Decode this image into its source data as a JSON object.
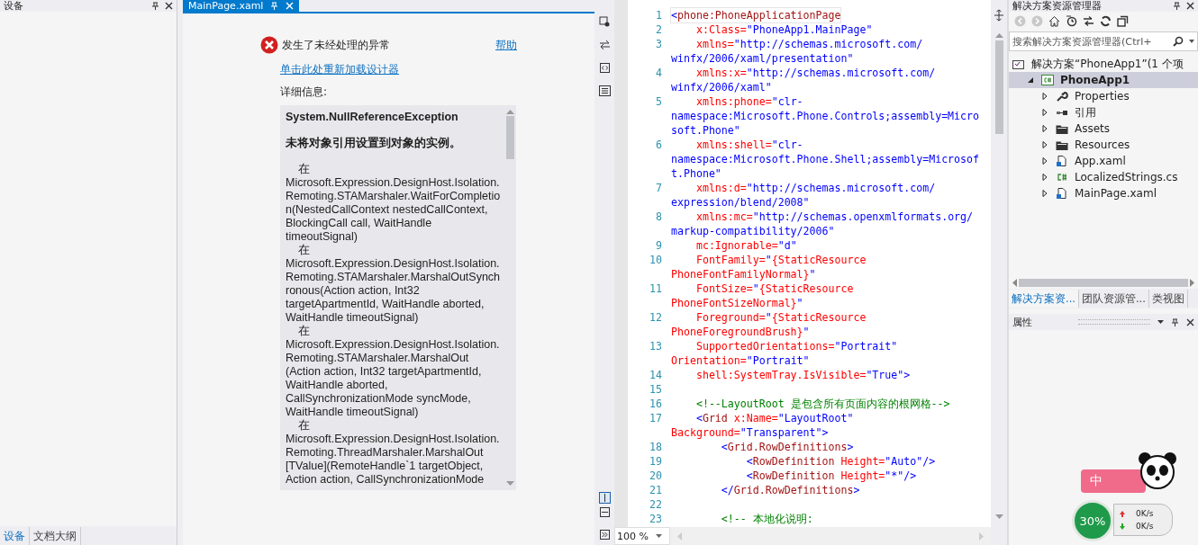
{
  "left_pane": {
    "title": "设备",
    "tabs": [
      {
        "label": "设备",
        "selected": true
      },
      {
        "label": "文档大纲",
        "selected": false
      }
    ]
  },
  "document_tab": {
    "title": "MainPage.xaml",
    "selected": true
  },
  "designer": {
    "error_title": "发生了未经处理的异常",
    "help_link": "帮助",
    "reload_link": "单击此处重新加载设计器",
    "details_label": "详细信息:",
    "exception": "System.NullReferenceException",
    "message": "未将对象引用设置到对象的实例。",
    "stack": [
      {
        "prefix": "在",
        "frame": "Microsoft.Expression.DesignHost.Isolation.Remoting.STAMarshaler.WaitForCompletion(NestedCallContext nestedCallContext, BlockingCall call, WaitHandle timeoutSignal)"
      },
      {
        "prefix": "在",
        "frame": "Microsoft.Expression.DesignHost.Isolation.Remoting.STAMarshaler.MarshalOutSynchronous(Action action, Int32 targetApartmentId, WaitHandle aborted, WaitHandle timeoutSignal)"
      },
      {
        "prefix": "在",
        "frame": "Microsoft.Expression.DesignHost.Isolation.Remoting.STAMarshaler.MarshalOut (Action action, Int32 targetApartmentId, WaitHandle aborted, CallSynchronizationMode syncMode, WaitHandle timeoutSignal)"
      },
      {
        "prefix": "在",
        "frame": "Microsoft.Expression.DesignHost.Isolation.Remoting.ThreadMarshaler.MarshalOut [TValue](RemoteHandle`1 targetObject, Action action, CallSynchronizationMode"
      }
    ]
  },
  "editor": {
    "zoom": "100 %",
    "lines": [
      {
        "number": "1",
        "rows": [
          {
            "segments": [
              {
                "kind": "punct",
                "text": "<"
              },
              {
                "kind": "element",
                "text": "phone:PhoneApplicationPage"
              }
            ]
          }
        ]
      },
      {
        "number": "2",
        "rows": [
          {
            "segments": [
              {
                "kind": "attribute",
                "text": "    x:Class="
              },
              {
                "kind": "value",
                "text": "\"PhoneApp1.MainPage\""
              }
            ]
          }
        ]
      },
      {
        "number": "3",
        "rows": [
          {
            "segments": [
              {
                "kind": "attribute",
                "text": "    xmlns="
              },
              {
                "kind": "value",
                "text": "\"http://schemas.microsoft.com/"
              }
            ]
          },
          {
            "segments": [
              {
                "kind": "value",
                "text": "winfx/2006/xaml/presentation\""
              }
            ]
          }
        ]
      },
      {
        "number": "4",
        "rows": [
          {
            "segments": [
              {
                "kind": "attribute",
                "text": "    xmlns:x="
              },
              {
                "kind": "value",
                "text": "\"http://schemas.microsoft.com/"
              }
            ]
          },
          {
            "segments": [
              {
                "kind": "value",
                "text": "winfx/2006/xaml\""
              }
            ]
          }
        ]
      },
      {
        "number": "5",
        "rows": [
          {
            "segments": [
              {
                "kind": "attribute",
                "text": "    xmlns:phone="
              },
              {
                "kind": "value",
                "text": "\"clr-"
              }
            ]
          },
          {
            "segments": [
              {
                "kind": "value",
                "text": "namespace:Microsoft.Phone.Controls;assembly=Micro"
              }
            ]
          },
          {
            "segments": [
              {
                "kind": "value",
                "text": "soft.Phone\""
              }
            ]
          }
        ]
      },
      {
        "number": "6",
        "rows": [
          {
            "segments": [
              {
                "kind": "attribute",
                "text": "    xmlns:shell="
              },
              {
                "kind": "value",
                "text": "\"clr-"
              }
            ]
          },
          {
            "segments": [
              {
                "kind": "value",
                "text": "namespace:Microsoft.Phone.Shell;assembly=Microsof"
              }
            ]
          },
          {
            "segments": [
              {
                "kind": "value",
                "text": "t.Phone\""
              }
            ]
          }
        ]
      },
      {
        "number": "7",
        "rows": [
          {
            "segments": [
              {
                "kind": "attribute",
                "text": "    xmlns:d="
              },
              {
                "kind": "value",
                "text": "\"http://schemas.microsoft.com/"
              }
            ]
          },
          {
            "segments": [
              {
                "kind": "value",
                "text": "expression/blend/2008\""
              }
            ]
          }
        ]
      },
      {
        "number": "8",
        "rows": [
          {
            "segments": [
              {
                "kind": "attribute",
                "text": "    xmlns:mc="
              },
              {
                "kind": "value",
                "text": "\"http://schemas.openxmlformats.org/"
              }
            ]
          },
          {
            "segments": [
              {
                "kind": "value",
                "text": "markup-compatibility/2006\""
              }
            ]
          }
        ]
      },
      {
        "number": "9",
        "rows": [
          {
            "segments": [
              {
                "kind": "attribute",
                "text": "    mc:Ignorable="
              },
              {
                "kind": "value",
                "text": "\"d\""
              }
            ]
          }
        ]
      },
      {
        "number": "10",
        "rows": [
          {
            "segments": [
              {
                "kind": "attribute",
                "text": "    FontFamily="
              },
              {
                "kind": "value",
                "text": "\""
              },
              {
                "kind": "attribute",
                "text": "{StaticResource"
              }
            ]
          },
          {
            "segments": [
              {
                "kind": "attribute",
                "text": "PhoneFontFamilyNormal}"
              },
              {
                "kind": "value",
                "text": "\""
              }
            ]
          }
        ]
      },
      {
        "number": "11",
        "rows": [
          {
            "segments": [
              {
                "kind": "attribute",
                "text": "    FontSize="
              },
              {
                "kind": "value",
                "text": "\""
              },
              {
                "kind": "attribute",
                "text": "{StaticResource"
              }
            ]
          },
          {
            "segments": [
              {
                "kind": "attribute",
                "text": "PhoneFontSizeNormal}"
              },
              {
                "kind": "value",
                "text": "\""
              }
            ]
          }
        ]
      },
      {
        "number": "12",
        "rows": [
          {
            "segments": [
              {
                "kind": "attribute",
                "text": "    Foreground="
              },
              {
                "kind": "value",
                "text": "\""
              },
              {
                "kind": "attribute",
                "text": "{StaticResource"
              }
            ]
          },
          {
            "segments": [
              {
                "kind": "attribute",
                "text": "PhoneForegroundBrush}"
              },
              {
                "kind": "value",
                "text": "\""
              }
            ]
          }
        ]
      },
      {
        "number": "13",
        "rows": [
          {
            "segments": [
              {
                "kind": "attribute",
                "text": "    SupportedOrientations="
              },
              {
                "kind": "value",
                "text": "\"Portrait\""
              }
            ]
          },
          {
            "segments": [
              {
                "kind": "attribute",
                "text": "Orientation="
              },
              {
                "kind": "value",
                "text": "\"Portrait\""
              }
            ]
          }
        ]
      },
      {
        "number": "14",
        "rows": [
          {
            "segments": [
              {
                "kind": "attribute",
                "text": "    shell:SystemTray.IsVisible="
              },
              {
                "kind": "value",
                "text": "\"True\">"
              }
            ]
          }
        ]
      },
      {
        "number": "15"
      },
      {
        "number": "16",
        "rows": [
          {
            "segments": [
              {
                "kind": "comment",
                "text": "    <!--LayoutRoot 是包含所有页面内容的根网格-->"
              }
            ]
          }
        ]
      },
      {
        "number": "17",
        "rows": [
          {
            "segments": [
              {
                "kind": "punct",
                "text": "    <"
              },
              {
                "kind": "element",
                "text": "Grid"
              },
              {
                "kind": "attribute",
                "text": " x:Name="
              },
              {
                "kind": "value",
                "text": "\"LayoutRoot\""
              }
            ]
          },
          {
            "segments": [
              {
                "kind": "attribute",
                "text": "Background="
              },
              {
                "kind": "value",
                "text": "\"Transparent\">"
              }
            ]
          }
        ]
      },
      {
        "number": "18",
        "rows": [
          {
            "segments": [
              {
                "kind": "punct",
                "text": "        <"
              },
              {
                "kind": "element",
                "text": "Grid.RowDefinitions"
              },
              {
                "kind": "punct",
                "text": ">"
              }
            ]
          }
        ]
      },
      {
        "number": "19",
        "rows": [
          {
            "segments": [
              {
                "kind": "punct",
                "text": "            <"
              },
              {
                "kind": "element",
                "text": "RowDefinition"
              },
              {
                "kind": "attribute",
                "text": " Height="
              },
              {
                "kind": "value",
                "text": "\"Auto\"/>"
              }
            ]
          }
        ]
      },
      {
        "number": "20",
        "rows": [
          {
            "segments": [
              {
                "kind": "punct",
                "text": "            <"
              },
              {
                "kind": "element",
                "text": "RowDefinition"
              },
              {
                "kind": "attribute",
                "text": " Height="
              },
              {
                "kind": "value",
                "text": "\"*\"/>"
              }
            ]
          }
        ]
      },
      {
        "number": "21",
        "rows": [
          {
            "segments": [
              {
                "kind": "punct",
                "text": "        </"
              },
              {
                "kind": "element",
                "text": "Grid.RowDefinitions"
              },
              {
                "kind": "punct",
                "text": ">"
              }
            ]
          }
        ]
      },
      {
        "number": "22"
      },
      {
        "number": "23",
        "rows": [
          {
            "segments": [
              {
                "kind": "comment",
                "text": "        <!-- 本地化说明:"
              }
            ]
          }
        ]
      }
    ]
  },
  "solution_explorer": {
    "title": "解决方案资源管理器",
    "search": {
      "placeholder": "搜索解决方案资源管理器(Ctrl+"
    },
    "tree": [
      {
        "label": "解决方案“PhoneApp1”(1 个项",
        "kind": "solution",
        "selected": false,
        "children": [
          {
            "label": "PhoneApp1",
            "kind": "project",
            "selected": true,
            "expanded": true,
            "children": [
              {
                "label": "Properties",
                "kind": "properties",
                "selected": false,
                "expanded": false
              },
              {
                "label": "引用",
                "kind": "references",
                "selected": false,
                "expanded": false
              },
              {
                "label": "Assets",
                "kind": "folder",
                "selected": false,
                "expanded": false
              },
              {
                "label": "Resources",
                "kind": "folder",
                "selected": false,
                "expanded": false
              },
              {
                "label": "App.xaml",
                "kind": "xaml",
                "selected": false,
                "expanded": false
              },
              {
                "label": "LocalizedStrings.cs",
                "kind": "csharp",
                "selected": false,
                "expanded": false
              },
              {
                "label": "MainPage.xaml",
                "kind": "xaml",
                "selected": false,
                "expanded": false
              }
            ]
          }
        ]
      }
    ],
    "tabs": [
      {
        "label": "解决方案资...",
        "selected": true
      },
      {
        "label": "团队资源管...",
        "selected": false
      },
      {
        "label": "类视图",
        "selected": false
      }
    ]
  },
  "properties_pane": {
    "title": "属性"
  },
  "speed_widget": {
    "badge": "中",
    "percent": "30%",
    "upload": "0K/s",
    "download": "0K/s"
  }
}
